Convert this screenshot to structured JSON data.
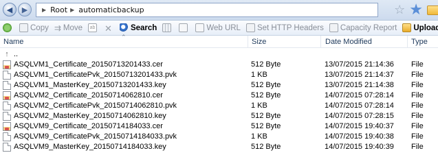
{
  "address": {
    "crumbs": [
      "Root",
      "automaticbackup"
    ]
  },
  "toolbar": {
    "copy": "Copy",
    "move": "Move",
    "search": "Search",
    "web_url": "Web URL",
    "set_http_headers": "Set HTTP Headers",
    "capacity_report": "Capacity Report",
    "upload_rules": "Upload Rules"
  },
  "columns": {
    "name": "Name",
    "size": "Size",
    "date_modified": "Date Modified",
    "type": "Type"
  },
  "up_row": {
    "name": ".."
  },
  "files": [
    {
      "name": "ASQLVM1_Certificate_20150713201433.cer",
      "size": "512 Byte",
      "date": "13/07/2015 21:14:36",
      "type": "File",
      "icon": "cert"
    },
    {
      "name": "ASQLVM1_CertificatePvk_20150713201433.pvk",
      "size": "1 KB",
      "date": "13/07/2015 21:14:37",
      "type": "File",
      "icon": "plain"
    },
    {
      "name": "ASQLVM1_MasterKey_20150713201433.key",
      "size": "512 Byte",
      "date": "13/07/2015 21:14:38",
      "type": "File",
      "icon": "plain"
    },
    {
      "name": "ASQLVM2_Certificate_20150714062810.cer",
      "size": "512 Byte",
      "date": "14/07/2015 07:28:14",
      "type": "File",
      "icon": "cert"
    },
    {
      "name": "ASQLVM2_CertificatePvk_20150714062810.pvk",
      "size": "1 KB",
      "date": "14/07/2015 07:28:14",
      "type": "File",
      "icon": "plain"
    },
    {
      "name": "ASQLVM2_MasterKey_20150714062810.key",
      "size": "512 Byte",
      "date": "14/07/2015 07:28:15",
      "type": "File",
      "icon": "plain"
    },
    {
      "name": "ASQLVM9_Certificate_20150714184033.cer",
      "size": "512 Byte",
      "date": "14/07/2015 19:40:37",
      "type": "File",
      "icon": "cert"
    },
    {
      "name": "ASQLVM9_CertificatePvk_20150714184033.pvk",
      "size": "1 KB",
      "date": "14/07/2015 19:40:38",
      "type": "File",
      "icon": "plain"
    },
    {
      "name": "ASQLVM9_MasterKey_20150714184033.key",
      "size": "512 Byte",
      "date": "14/07/2015 19:40:39",
      "type": "File",
      "icon": "plain"
    }
  ]
}
